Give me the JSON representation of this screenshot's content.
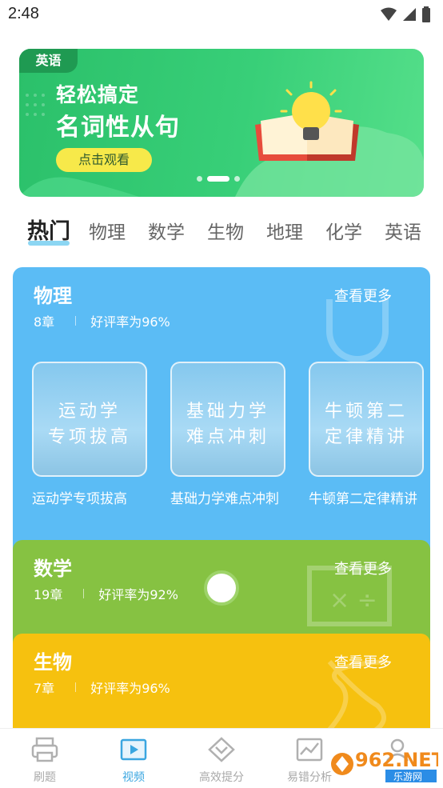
{
  "status_bar": {
    "time": "2:48",
    "icons": [
      "wifi-icon",
      "signal-icon",
      "battery-icon"
    ]
  },
  "banner": {
    "tag": "英语",
    "line1": "轻松搞定",
    "line2": "名词性从句",
    "cta": "点击观看",
    "colors": {
      "background": "#36c974",
      "tag": "#1f9a52",
      "cta": "#f7e94a"
    }
  },
  "tabs": [
    {
      "label": "热门",
      "active": true
    },
    {
      "label": "物理"
    },
    {
      "label": "数学"
    },
    {
      "label": "生物"
    },
    {
      "label": "地理"
    },
    {
      "label": "化学"
    },
    {
      "label": "英语"
    }
  ],
  "subjects": [
    {
      "title": "物理",
      "chapters": "8章",
      "rating": "好评率为96%",
      "more": "查看更多",
      "color": "#5bbcf5",
      "courses": [
        {
          "thumb_line1": "运动学",
          "thumb_line2": "专项拔高",
          "label": "运动学专项拔高"
        },
        {
          "thumb_line1": "基础力学",
          "thumb_line2": "难点冲刺",
          "label": "基础力学难点冲刺"
        },
        {
          "thumb_line1": "牛顿第二",
          "thumb_line2": "定律精讲",
          "label": "牛顿第二定律精讲"
        }
      ]
    },
    {
      "title": "数学",
      "chapters": "19章",
      "rating": "好评率为92%",
      "more": "查看更多",
      "color": "#86c242"
    },
    {
      "title": "生物",
      "chapters": "7章",
      "rating": "好评率为96%",
      "more": "查看更多",
      "color": "#f6c10f"
    }
  ],
  "bottom_nav": [
    {
      "label": "刷题",
      "icon": "printer-icon"
    },
    {
      "label": "视频",
      "icon": "video-icon",
      "active": true
    },
    {
      "label": "高效提分",
      "icon": "chevron-badge-icon"
    },
    {
      "label": "易错分析",
      "icon": "chart-icon"
    },
    {
      "label": "",
      "icon": "profile-icon"
    }
  ],
  "watermark": {
    "text": "962.NET",
    "sub": "乐游网"
  }
}
